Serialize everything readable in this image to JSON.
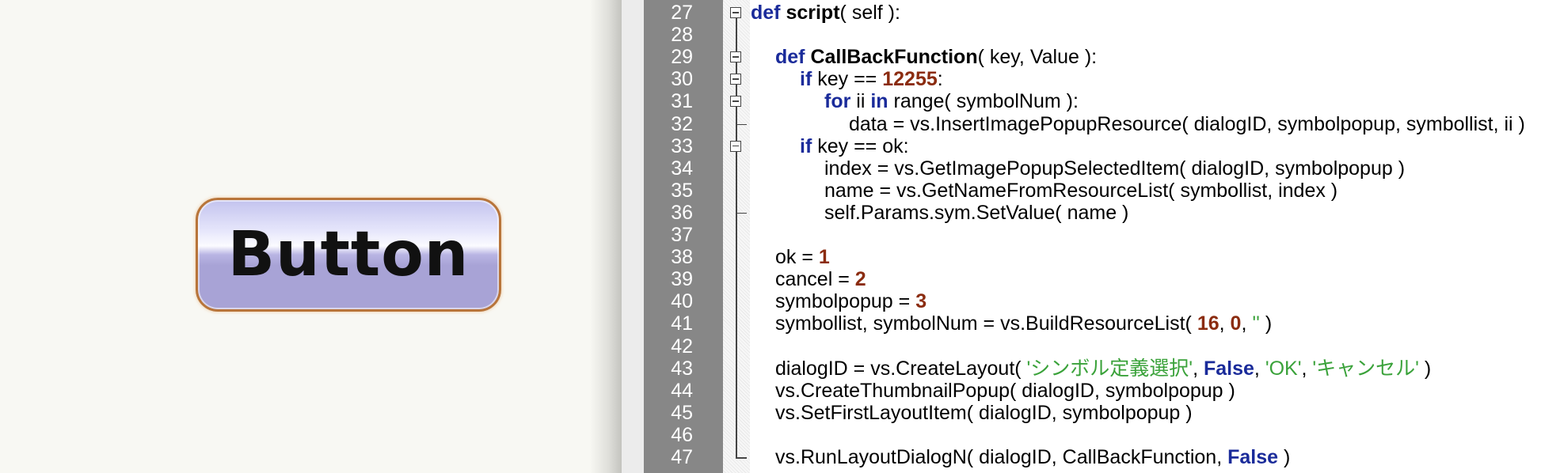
{
  "preview": {
    "button_label": "Button"
  },
  "editor": {
    "lines": [
      {
        "n": "27",
        "fold": "box",
        "indent": 0,
        "tokens": [
          {
            "t": "def",
            "c": "kw"
          },
          {
            "t": " "
          },
          {
            "t": "script",
            "c": "fn"
          },
          {
            "t": "( self ):"
          }
        ]
      },
      {
        "n": "28",
        "fold": "line",
        "indent": 0,
        "tokens": []
      },
      {
        "n": "29",
        "fold": "box",
        "indent": 1,
        "tokens": [
          {
            "t": "def",
            "c": "kw"
          },
          {
            "t": " "
          },
          {
            "t": "CallBackFunction",
            "c": "fn"
          },
          {
            "t": "( key, Value ):"
          }
        ]
      },
      {
        "n": "30",
        "fold": "box",
        "indent": 2,
        "tokens": [
          {
            "t": "if",
            "c": "kw"
          },
          {
            "t": " key == "
          },
          {
            "t": "12255",
            "c": "num"
          },
          {
            "t": ":"
          }
        ]
      },
      {
        "n": "31",
        "fold": "box",
        "indent": 3,
        "tokens": [
          {
            "t": "for",
            "c": "kw"
          },
          {
            "t": " ii "
          },
          {
            "t": "in",
            "c": "kw"
          },
          {
            "t": " range( symbolNum ):"
          }
        ]
      },
      {
        "n": "32",
        "fold": "end",
        "indent": 4,
        "tokens": [
          {
            "t": "data = vs.InsertImagePopupResource( dialogID, symbolpopup, symbollist, ii )"
          }
        ]
      },
      {
        "n": "33",
        "fold": "box",
        "indent": 2,
        "tokens": [
          {
            "t": "if",
            "c": "kw"
          },
          {
            "t": " key == ok:"
          }
        ]
      },
      {
        "n": "34",
        "fold": "line",
        "indent": 3,
        "tokens": [
          {
            "t": "index = vs.GetImagePopupSelectedItem( dialogID, symbolpopup )"
          }
        ]
      },
      {
        "n": "35",
        "fold": "line",
        "indent": 3,
        "tokens": [
          {
            "t": "name = vs.GetNameFromResourceList( symbollist, index )"
          }
        ]
      },
      {
        "n": "36",
        "fold": "end",
        "indent": 3,
        "tokens": [
          {
            "t": "self.Params.sym.SetValue( name )"
          }
        ]
      },
      {
        "n": "37",
        "fold": "line",
        "indent": 0,
        "tokens": []
      },
      {
        "n": "38",
        "fold": "line",
        "indent": 1,
        "tokens": [
          {
            "t": "ok = "
          },
          {
            "t": "1",
            "c": "num"
          }
        ]
      },
      {
        "n": "39",
        "fold": "line",
        "indent": 1,
        "tokens": [
          {
            "t": "cancel = "
          },
          {
            "t": "2",
            "c": "num"
          }
        ]
      },
      {
        "n": "40",
        "fold": "line",
        "indent": 1,
        "tokens": [
          {
            "t": "symbolpopup = "
          },
          {
            "t": "3",
            "c": "num"
          }
        ]
      },
      {
        "n": "41",
        "fold": "line",
        "indent": 1,
        "tokens": [
          {
            "t": "symbollist, symbolNum = vs.BuildResourceList( "
          },
          {
            "t": "16",
            "c": "num"
          },
          {
            "t": ", "
          },
          {
            "t": "0",
            "c": "num"
          },
          {
            "t": ", "
          },
          {
            "t": "''",
            "c": "str"
          },
          {
            "t": " )"
          }
        ]
      },
      {
        "n": "42",
        "fold": "line",
        "indent": 0,
        "tokens": []
      },
      {
        "n": "43",
        "fold": "line",
        "indent": 1,
        "tokens": [
          {
            "t": "dialogID = vs.CreateLayout( "
          },
          {
            "t": "'シンボル定義選択'",
            "c": "str"
          },
          {
            "t": ", "
          },
          {
            "t": "False",
            "c": "kw"
          },
          {
            "t": ", "
          },
          {
            "t": "'OK'",
            "c": "str"
          },
          {
            "t": ", "
          },
          {
            "t": "'キャンセル'",
            "c": "str"
          },
          {
            "t": " )"
          }
        ]
      },
      {
        "n": "44",
        "fold": "line",
        "indent": 1,
        "tokens": [
          {
            "t": "vs.CreateThumbnailPopup( dialogID, symbolpopup )"
          }
        ]
      },
      {
        "n": "45",
        "fold": "line",
        "indent": 1,
        "tokens": [
          {
            "t": "vs.SetFirstLayoutItem( dialogID, symbolpopup )"
          }
        ]
      },
      {
        "n": "46",
        "fold": "line",
        "indent": 0,
        "tokens": []
      },
      {
        "n": "47",
        "fold": "end",
        "indent": 1,
        "tokens": [
          {
            "t": "vs.RunLayoutDialogN( dialogID, CallBackFunction, "
          },
          {
            "t": "False",
            "c": "kw"
          },
          {
            "t": " )"
          }
        ]
      }
    ]
  }
}
